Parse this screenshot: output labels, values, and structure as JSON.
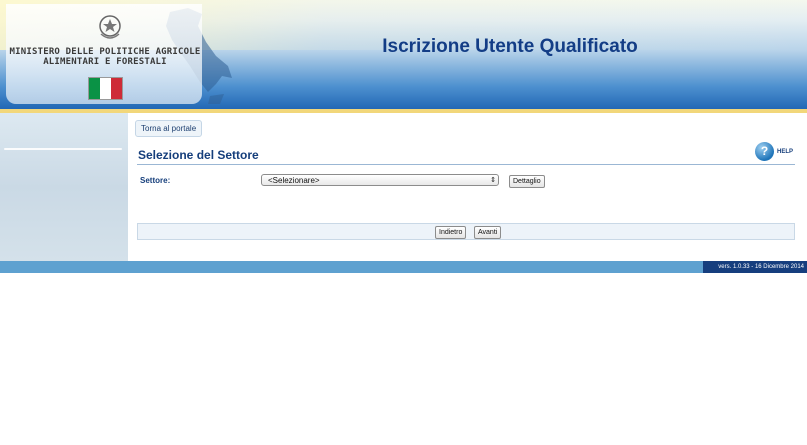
{
  "header": {
    "ministry_line1": "MINISTERO DELLE POLITICHE AGRICOLE",
    "ministry_line2": "ALIMENTARI E FORESTALI",
    "app_title": "Iscrizione Utente Qualificato"
  },
  "nav": {
    "portal_link": "Torna al portale"
  },
  "main": {
    "section_title": "Selezione del Settore",
    "help_label": "HELP",
    "help_icon_glyph": "?",
    "field_label": "Settore:",
    "select_value": "<Selezionare>",
    "detail_button": "Dettaglio",
    "back_button": "Indietro",
    "next_button": "Avanti"
  },
  "footer": {
    "version": "vers. 1.0.33 - 16 Dicembre 2014"
  },
  "colors": {
    "brand_blue": "#133d86",
    "footer_light": "#5ea1d0",
    "footer_dark": "#163e7e",
    "flag_green": "#0a9245",
    "flag_red": "#ce2b37"
  }
}
